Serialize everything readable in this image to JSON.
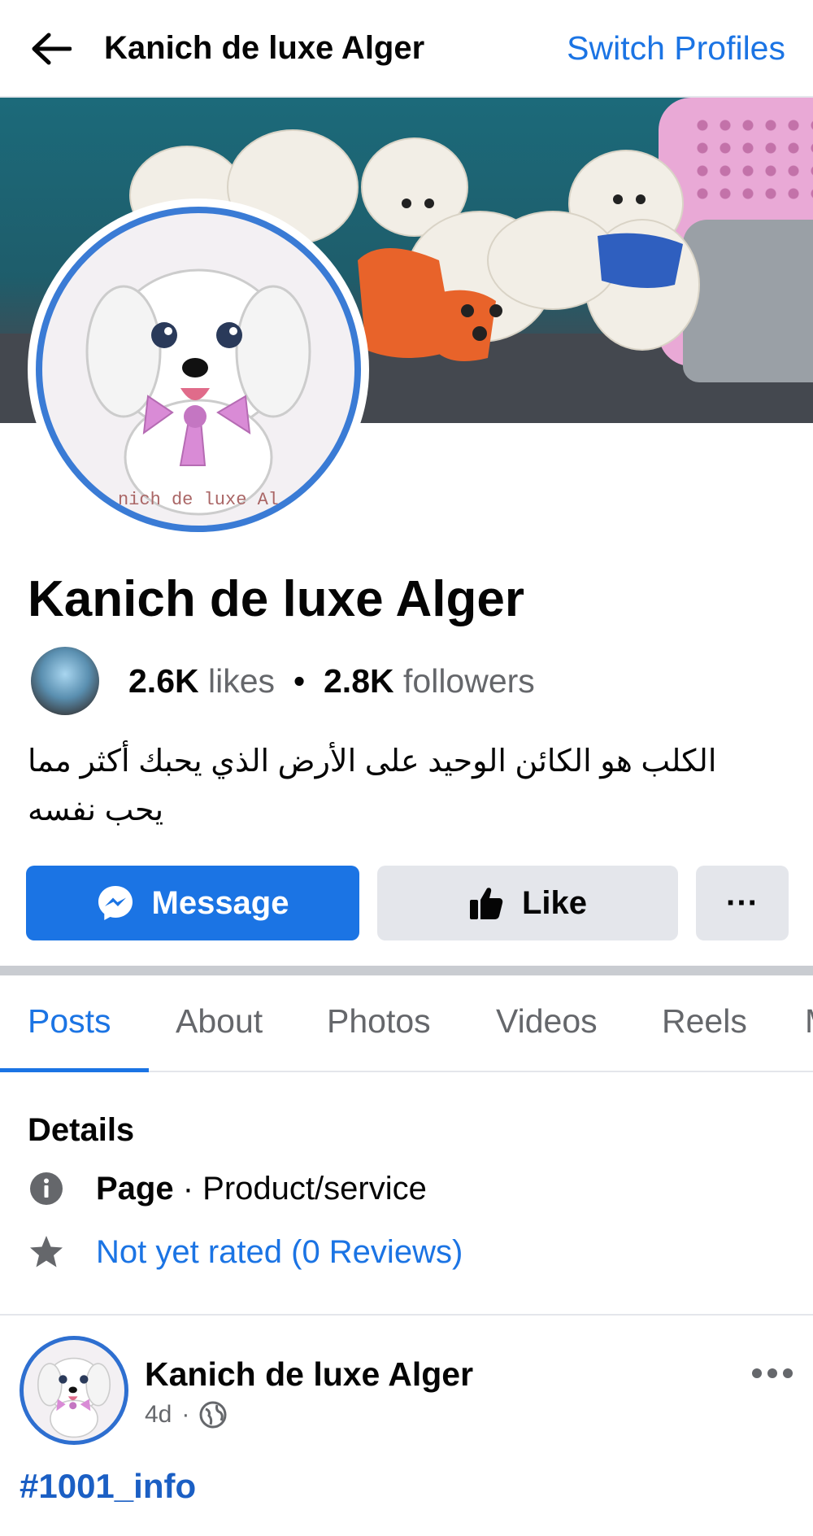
{
  "topbar": {
    "title": "Kanich de luxe Alger",
    "switch_label": "Switch Profiles"
  },
  "profile": {
    "name": "Kanich de luxe Alger",
    "watermark": "nich de luxe Al",
    "likes_count": "2.6K",
    "likes_label": "likes",
    "separator": "•",
    "followers_count": "2.8K",
    "followers_label": "followers",
    "bio_line1": "الكلب هو الكائن الوحيد على الأرض الذي يحبك أكثر مما",
    "bio_line2": "يحب نفسه"
  },
  "actions": {
    "message_label": "Message",
    "like_label": "Like",
    "more_label": "···"
  },
  "tabs": [
    {
      "label": "Posts",
      "active": true
    },
    {
      "label": "About",
      "active": false
    },
    {
      "label": "Photos",
      "active": false
    },
    {
      "label": "Videos",
      "active": false
    },
    {
      "label": "Reels",
      "active": false
    },
    {
      "label": "M",
      "active": false
    }
  ],
  "details": {
    "heading": "Details",
    "page_label": "Page",
    "page_separator": " · ",
    "page_category": "Product/service",
    "rating_label": "Not yet rated (0 Reviews)"
  },
  "post": {
    "author": "Kanich de luxe Alger",
    "time": "4d",
    "meta_separator": "·",
    "hashtag": "#1001_info"
  },
  "colors": {
    "accent": "#1b74e4",
    "button_gray": "#e4e6eb",
    "text_secondary": "#65676b"
  },
  "icons": {
    "back": "arrow-left-icon",
    "messenger": "messenger-icon",
    "like": "thumbs-up-icon",
    "info": "info-icon",
    "star": "star-icon",
    "globe": "globe-icon",
    "more": "more-horizontal-icon"
  }
}
